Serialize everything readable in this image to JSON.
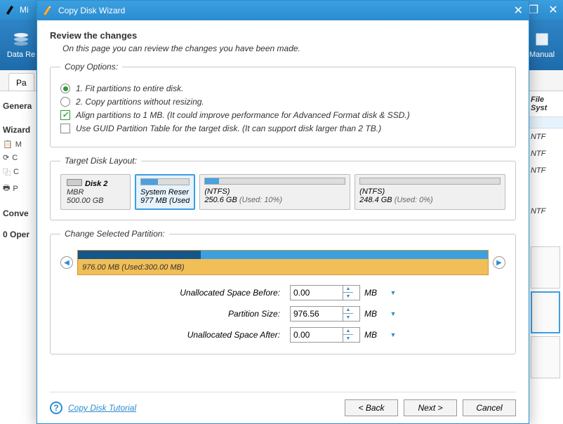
{
  "bg": {
    "title": "Mi",
    "toolbar": {
      "left": "Data Re",
      "right": "Manual"
    },
    "tabs": [
      "Pa"
    ],
    "left_section1": "Genera",
    "left_header": "Wizard",
    "left_items": [
      "M",
      "C",
      "C",
      "P"
    ],
    "left_section2": "Conve",
    "left_section3": "0 Oper",
    "right_header": "File Syst",
    "right_cells": [
      "NTF",
      "NTF",
      "NTF",
      "NTF"
    ]
  },
  "dialog": {
    "title": "Copy Disk Wizard",
    "heading": "Review the changes",
    "sub": "On this page you can review the changes you have been made."
  },
  "copy_options": {
    "legend": "Copy Options:",
    "opt1": "1. Fit partitions to entire disk.",
    "opt2": "2. Copy partitions without resizing.",
    "align": "Align partitions to 1 MB.  (It could improve performance for Advanced Format disk & SSD.)",
    "guid": "Use GUID Partition Table for the target disk. (It can support disk larger than 2 TB.)"
  },
  "layout": {
    "legend": "Target Disk Layout:",
    "disk": {
      "name": "Disk 2",
      "type": "MBR",
      "size": "500.00 GB"
    },
    "parts": [
      {
        "name": "System Reser",
        "size": "977 MB (Used",
        "fill": 35,
        "selected": true,
        "flex": 0.7
      },
      {
        "name": "(NTFS)",
        "size": "250.6 GB",
        "used": "(Used: 10%)",
        "fill": 10,
        "flex": 2
      },
      {
        "name": "(NTFS)",
        "size": "248.4 GB",
        "used": "(Used: 0%)",
        "fill": 0,
        "flex": 2
      }
    ]
  },
  "change": {
    "legend": "Change Selected Partition:",
    "slider_label": "976.00 MB (Used:300.00 MB)",
    "rows": [
      {
        "label": "Unallocated Space Before:",
        "value": "0.00",
        "unit": "MB"
      },
      {
        "label": "Partition Size:",
        "value": "976.56",
        "unit": "MB"
      },
      {
        "label": "Unallocated Space After:",
        "value": "0.00",
        "unit": "MB"
      }
    ]
  },
  "footer": {
    "tutorial": "Copy Disk Tutorial",
    "back": "< Back",
    "next": "Next >",
    "cancel": "Cancel"
  }
}
